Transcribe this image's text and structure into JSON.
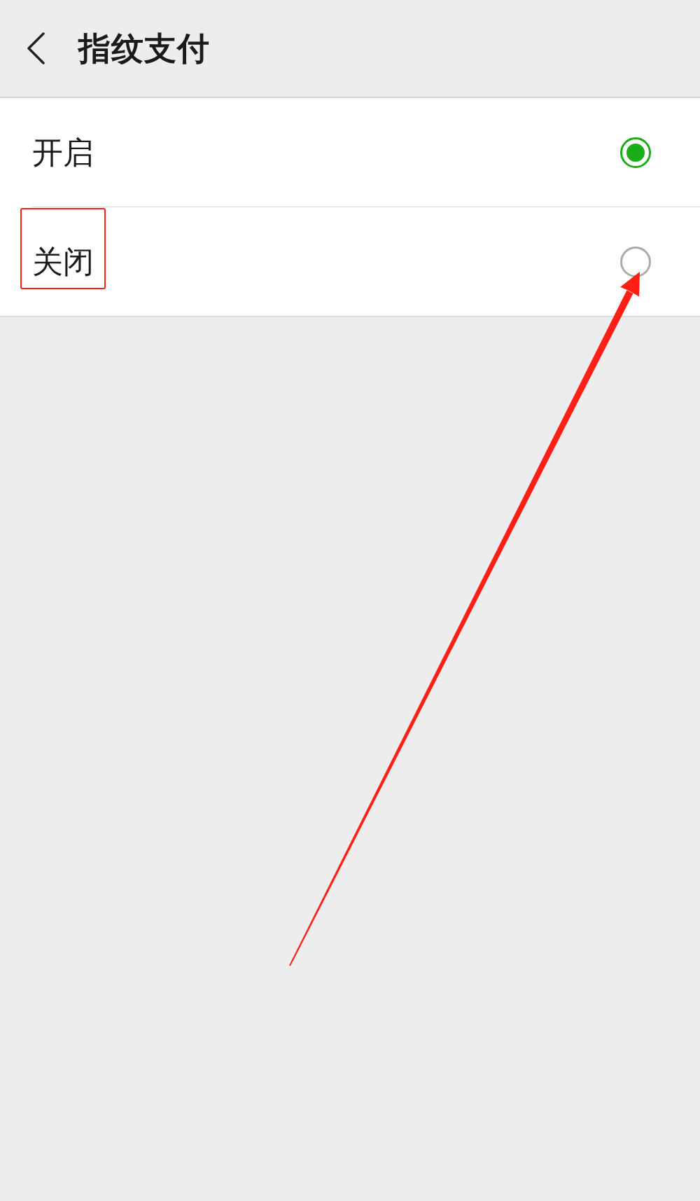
{
  "header": {
    "title": "指纹支付"
  },
  "options": [
    {
      "label": "开启",
      "selected": true
    },
    {
      "label": "关闭",
      "selected": false
    }
  ]
}
